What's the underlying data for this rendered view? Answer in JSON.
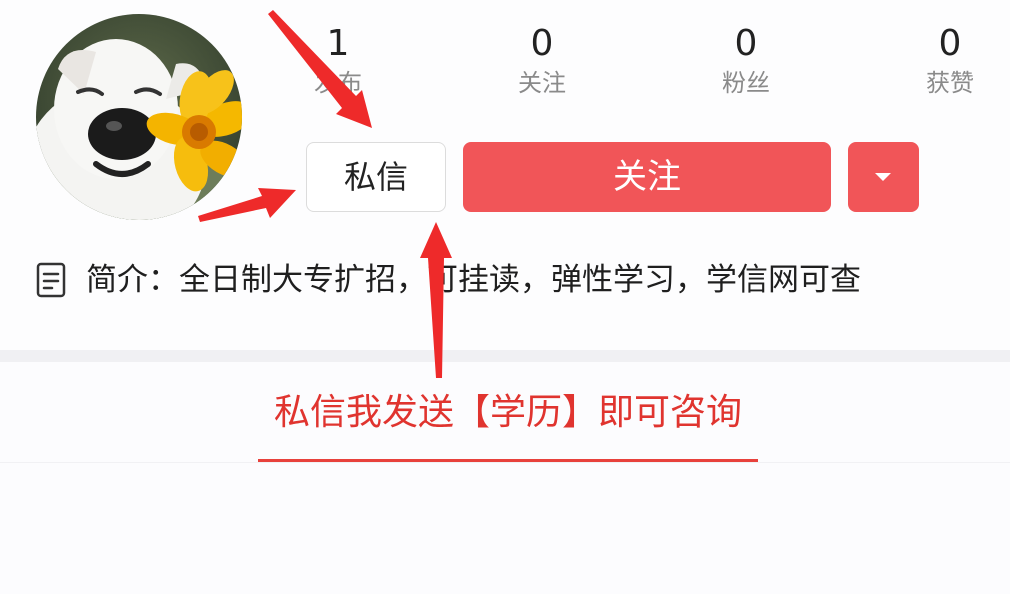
{
  "stats": {
    "posts": {
      "value": "1",
      "label": "发布"
    },
    "following": {
      "value": "0",
      "label": "关注"
    },
    "followers": {
      "value": "0",
      "label": "粉丝"
    },
    "likes": {
      "value": "0",
      "label": "获赞"
    }
  },
  "actions": {
    "message_label": "私信",
    "follow_label": "关注"
  },
  "bio": {
    "text": "简介：全日制大专扩招，可挂读，弹性学习，学信网可查"
  },
  "annotation": {
    "text": "私信我发送【学历】即可咨询"
  },
  "colors": {
    "accent": "#f15558",
    "annotation": "#e0342f",
    "arrow": "#ee2a2a"
  }
}
